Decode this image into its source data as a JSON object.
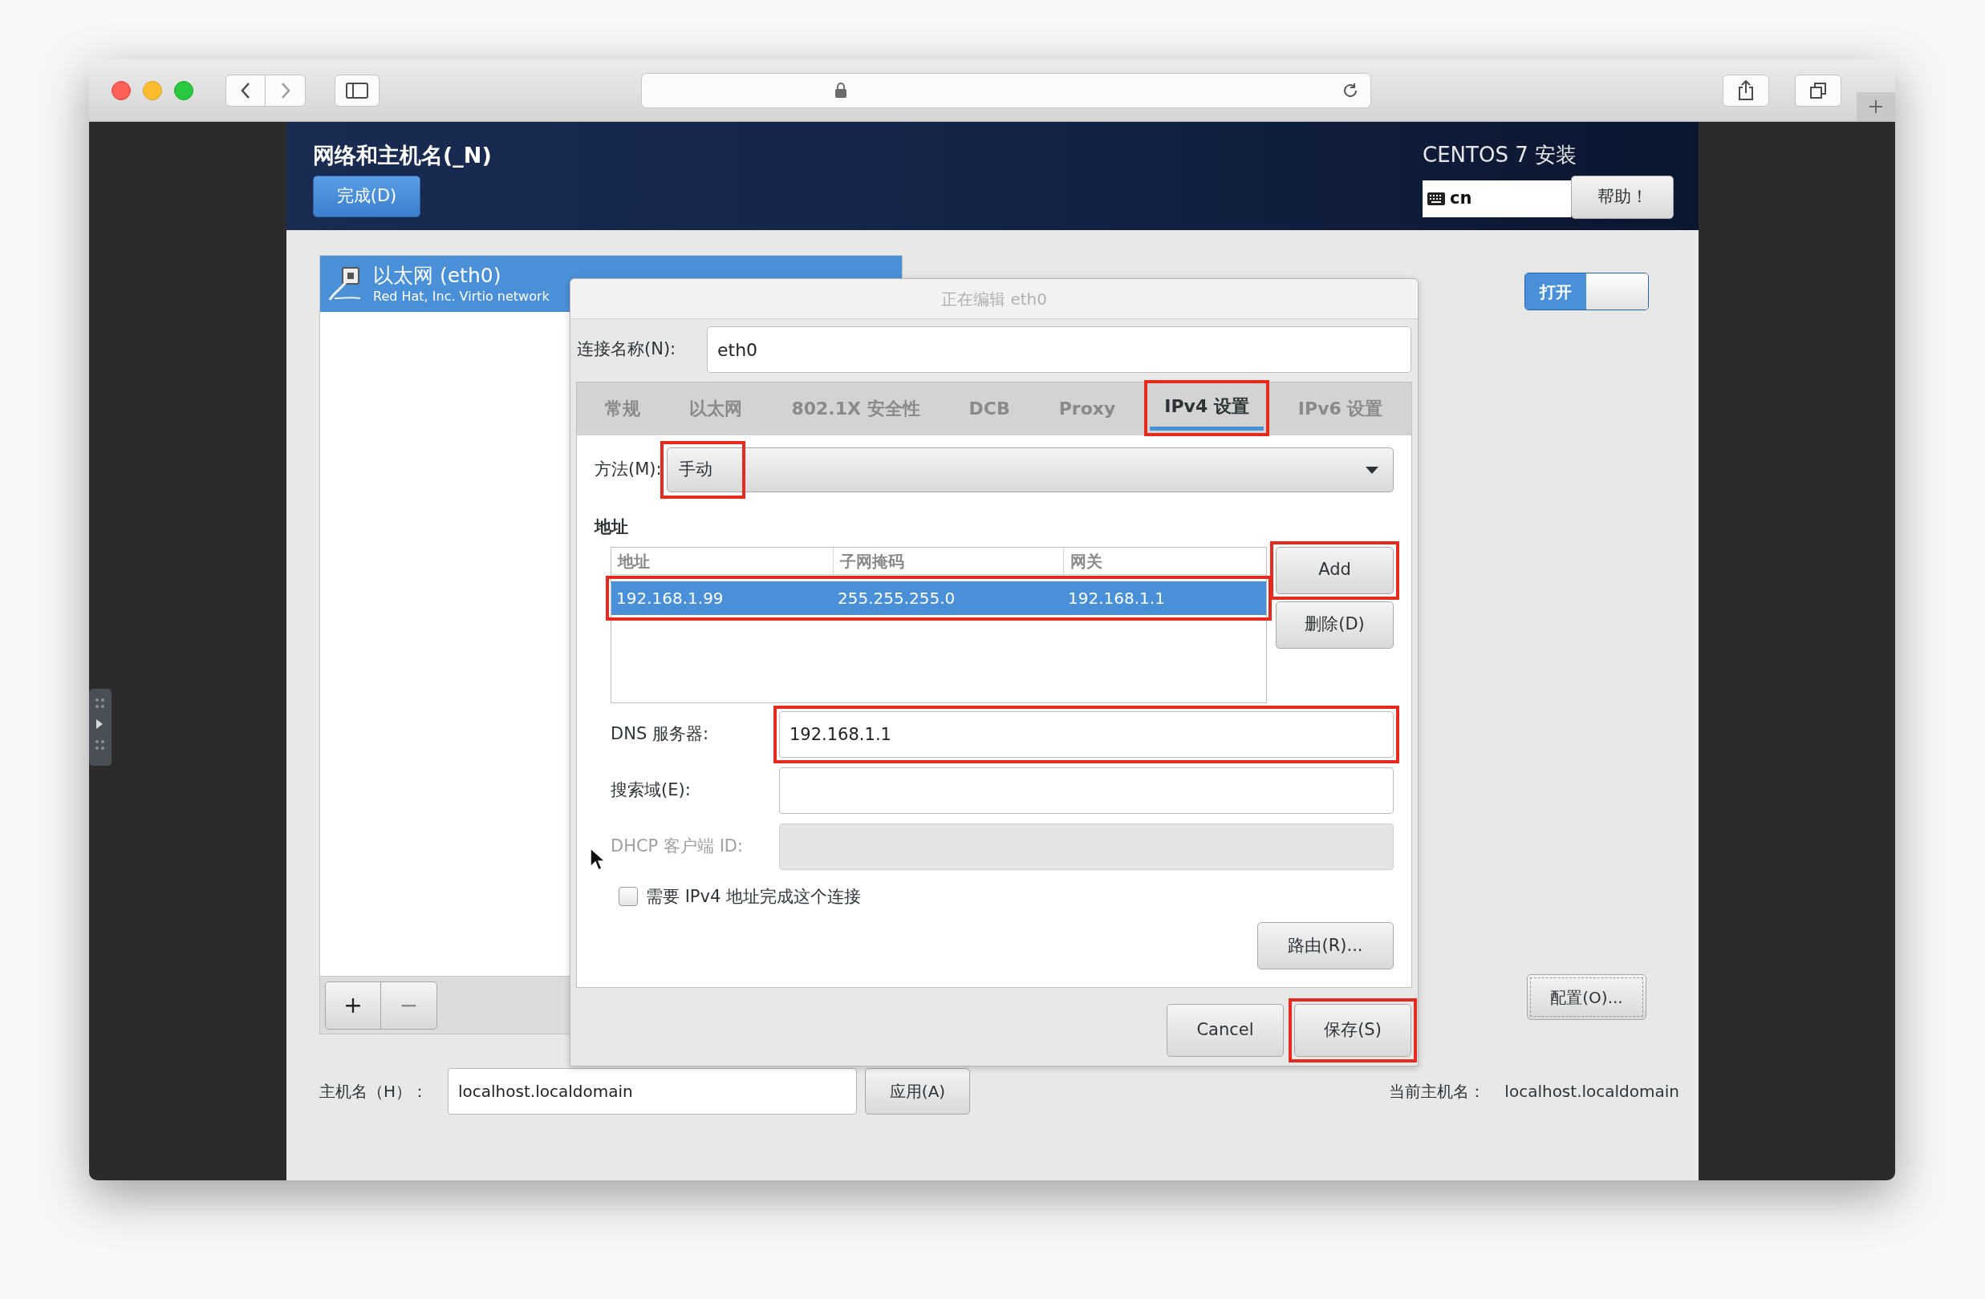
{
  "installer": {
    "title": "网络和主机名(_N)",
    "done_button": "完成(D)",
    "product": "CENTOS 7 安装",
    "keyboard_layout": "cn",
    "help_button": "帮助！"
  },
  "devices": [
    {
      "name": "以太网 (eth0)",
      "description": "Red Hat, Inc. Virtio network",
      "selected": true
    }
  ],
  "list_buttons": [
    "+",
    "−"
  ],
  "device_switch": {
    "label": "打开",
    "on": true
  },
  "configure_button": "配置(O)...",
  "dialog": {
    "title": "正在编辑 eth0",
    "connection_name_label": "连接名称(N):",
    "connection_name": "eth0",
    "tabs": [
      {
        "label": "常规",
        "selected": false,
        "highlighted": false
      },
      {
        "label": "以太网",
        "selected": false,
        "highlighted": false
      },
      {
        "label": "802.1X 安全性",
        "selected": false,
        "highlighted": false
      },
      {
        "label": "DCB",
        "selected": false,
        "highlighted": false
      },
      {
        "label": "Proxy",
        "selected": false,
        "highlighted": false
      },
      {
        "label": "IPv4 设置",
        "selected": true,
        "highlighted": true
      },
      {
        "label": "IPv6 设置",
        "selected": false,
        "highlighted": false
      }
    ],
    "method_label": "方法(M):",
    "method": {
      "value": "手动",
      "highlighted": true
    },
    "address_heading": "地址",
    "address_columns": [
      "地址",
      "子网掩码",
      "网关"
    ],
    "address_rows": [
      {
        "cells": [
          "192.168.1.99",
          "255.255.255.0",
          "192.168.1.1"
        ],
        "selected": true,
        "highlighted": true
      }
    ],
    "add_button": {
      "label": "Add",
      "highlighted": true
    },
    "delete_button": "删除(D)",
    "fields": [
      {
        "label": "DNS 服务器:",
        "value": "192.168.1.1",
        "disabled": false,
        "highlighted": true
      },
      {
        "label": "搜索域(E):",
        "disabled": false,
        "highlighted": false
      },
      {
        "label": "DHCP 客户端 ID:",
        "disabled": true,
        "highlighted": false
      }
    ],
    "require_ipv4": {
      "label": "需要 IPv4 地址完成这个连接",
      "checked": false
    },
    "routes_button": "路由(R)...",
    "cancel_button": "Cancel",
    "save_button": {
      "label": "保存(S)",
      "highlighted": true
    }
  },
  "hostname": {
    "label": "主机名（H）：",
    "value": "localhost.localdomain",
    "apply_button": "应用(A)",
    "current_label": "当前主机名：",
    "current_value": "localhost.localdomain"
  }
}
